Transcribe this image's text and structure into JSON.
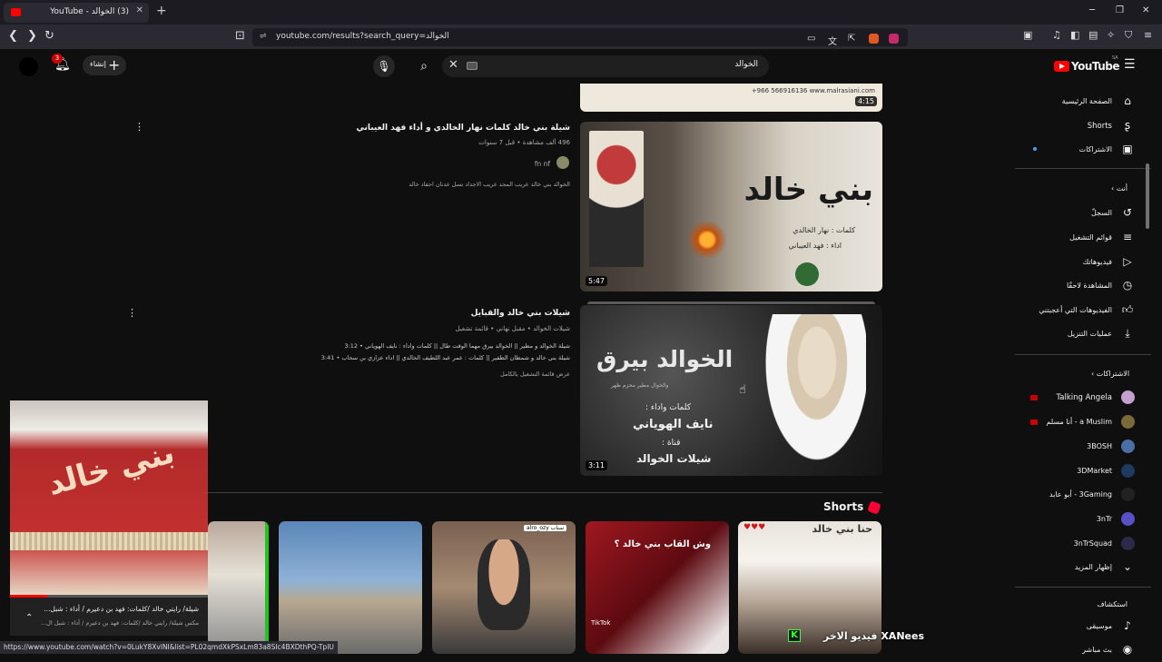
{
  "browser": {
    "tab_title": "(3) الخوالد - YouTube",
    "url": "youtube.com/results?search_query=الخوالد",
    "status_url": "https://www.youtube.com/watch?v=0LukY8XvlNI&list=PL02qmdXkPSxLm83a8SIc4BXDthPQ-TpIU",
    "min": "─",
    "max": "❐",
    "close": "✕"
  },
  "header": {
    "search_query": "الخوالد",
    "create_label": "إنشاء",
    "notif_count": "3",
    "logo_text": "YouTube",
    "region": "SA"
  },
  "sidebar": {
    "main": [
      {
        "label": "الصفحة الرئيسية",
        "icon": "home-icon"
      },
      {
        "label": "Shorts",
        "icon": "shorts-icon"
      },
      {
        "label": "الاشتراكات",
        "icon": "subscriptions-icon"
      }
    ],
    "you_heading": "أنت",
    "you": [
      {
        "label": "السجلّ",
        "icon": "history-icon"
      },
      {
        "label": "قوائم التشغيل",
        "icon": "playlists-icon"
      },
      {
        "label": "فيديوهاتك",
        "icon": "your-videos-icon"
      },
      {
        "label": "المشاهدة لاحقًا",
        "icon": "watch-later-icon"
      },
      {
        "label": "الفيديوهات التي أعجبتني",
        "icon": "liked-icon"
      },
      {
        "label": "عمليات التنزيل",
        "icon": "download-icon"
      }
    ],
    "subs_heading": "الاشتراكات",
    "subs": [
      {
        "label": "Talking Angela",
        "color": "#c4a0d0"
      },
      {
        "label": "a Muslim - أنا مسلم",
        "color": "#7a6a3a"
      },
      {
        "label": "3BOSH",
        "color": "#4a6fa5"
      },
      {
        "label": "3DMarket",
        "color": "#1e3a5f"
      },
      {
        "label": "3Gaming - أبو عابد",
        "color": "#222222"
      },
      {
        "label": "3nTr",
        "color": "#5a4fc4"
      },
      {
        "label": "3nTrSquad",
        "color": "#2a2a4a"
      }
    ],
    "show_more": "إظهار المزيد",
    "explore_heading": "استكشاف",
    "explore": [
      {
        "label": "موسيقى",
        "icon": "music-icon"
      },
      {
        "label": "بث مباشر",
        "icon": "live-icon"
      }
    ]
  },
  "results": [
    {
      "duration": "4:15",
      "thumb_text": "+966 566916136  www.malrasiani.com",
      "partial": true
    },
    {
      "title": "شيلة بني خالد كلمات نهار الخالدي و أداء فهد العيباني",
      "meta": "496 ألف مشاهدة • قبل 7 سنوات",
      "channel": "fn nf",
      "desc": "الخوالد بني خالد عريب المجد عريب الاجداد نسل عدنان احفاد خالد",
      "duration": "5:47",
      "thumb_big": "بني خالد",
      "thumb_line1": "كلمات : نهار الخالدي",
      "thumb_line2": "اداء : فهد العيباني"
    },
    {
      "title": "شيلات بني خالد والقبايل",
      "meta": "شيلات الخوالد • مقبل نهاني • قائمة تشغيل",
      "track1": "شيلة الخوالد و مطير || الخوالد بيرق مهما الوقت طال || كلمات واداء : نايف الهوياني • 3:12",
      "track2": "شيلة بني خالد و شمطان الظفير || كلمات : عمر عبد اللطيف الخالدي || اداء عزازي بن سحاب • 3:41",
      "full_list": "عرض قائمة التشغيل بالكامل",
      "duration": "3:11",
      "thumb_big": "الخوالد بيرق",
      "thumb_sub": "والخوال مطير محزم ظهر",
      "thumb_line1": "كلمات واداء :",
      "thumb_line2": "نايف الهوياني",
      "thumb_line3": "قناة :",
      "thumb_line4": "شيلات الخوالد"
    }
  ],
  "shorts": {
    "heading": "Shorts",
    "items": [
      {
        "text": "",
        "color": "#c9b8a8"
      },
      {
        "text": "",
        "color": "#6d8fb5"
      },
      {
        "text": "alro_ozy سناب",
        "color": "#8a7060"
      },
      {
        "text": "وش القاب بني خالد ؟",
        "tiktok": "TikTok",
        "color": "#7a0f14"
      },
      {
        "text": "حنا بني خالد",
        "color": "#d9d4cc"
      }
    ]
  },
  "miniplayer": {
    "title": "شيلة/ رايتي خالد /كلمات: فهد بن دعيرم / أداء : شبل...",
    "subtitle": "مكس شيلة/ رايتي خالد /كلمات: فهد بن دعيرم / أداء : شبل ال...",
    "progress": 0.19,
    "flag_text": "بني خالد"
  },
  "overlay_text": "فيديو الاخر XANees"
}
